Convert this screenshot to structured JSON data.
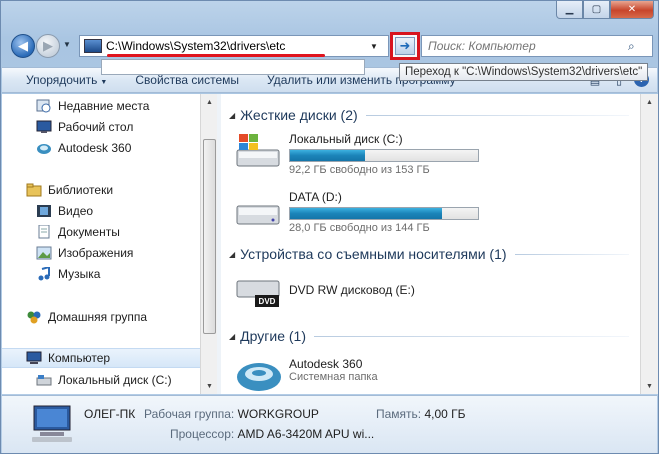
{
  "window": {
    "caption": {
      "minimize": "▁",
      "maximize": "▢",
      "close": "✕"
    }
  },
  "nav": {
    "address_value": "C:\\Windows\\System32\\drivers\\etc",
    "search_placeholder": "Поиск: Компьютер",
    "go_tooltip": "Переход к \"C:\\Windows\\System32\\drivers\\etc\""
  },
  "toolbar": {
    "organize": "Упорядочить",
    "system_properties": "Свойства системы",
    "uninstall": "Удалить или изменить программу"
  },
  "sidebar": {
    "items": [
      {
        "label": "Недавние места",
        "icon": "recent-places-icon"
      },
      {
        "label": "Рабочий стол",
        "icon": "desktop-icon"
      },
      {
        "label": "Autodesk 360",
        "icon": "autodesk-icon"
      },
      {
        "label": "Библиотеки",
        "icon": "libraries-icon"
      },
      {
        "label": "Видео",
        "icon": "video-icon"
      },
      {
        "label": "Документы",
        "icon": "documents-icon"
      },
      {
        "label": "Изображения",
        "icon": "pictures-icon"
      },
      {
        "label": "Музыка",
        "icon": "music-icon"
      },
      {
        "label": "Домашняя группа",
        "icon": "homegroup-icon"
      },
      {
        "label": "Компьютер",
        "icon": "computer-icon"
      },
      {
        "label": "Локальный диск (C:)",
        "icon": "drive-icon"
      }
    ]
  },
  "content": {
    "groups": [
      {
        "title": "Жесткие диски (2)"
      },
      {
        "title": "Устройства со съемными носителями (1)"
      },
      {
        "title": "Другие (1)"
      }
    ],
    "drives": [
      {
        "name": "Локальный диск (C:)",
        "free_text": "92,2 ГБ свободно из 153 ГБ",
        "used_fraction": 0.4
      },
      {
        "name": "DATA (D:)",
        "free_text": "28,0 ГБ свободно из 144 ГБ",
        "used_fraction": 0.81
      }
    ],
    "removable": [
      {
        "name": "DVD RW дисковод (E:)",
        "badge": "DVD"
      }
    ],
    "other": [
      {
        "name": "Autodesk 360",
        "subtitle": "Системная папка"
      }
    ]
  },
  "status": {
    "computer_name": "ОЛЕГ-ПК",
    "workgroup_label": "Рабочая группа:",
    "workgroup_value": "WORKGROUP",
    "memory_label": "Память:",
    "memory_value": "4,00 ГБ",
    "cpu_label": "Процессор:",
    "cpu_value": "AMD A6-3420M APU wi..."
  },
  "colors": {
    "accent_red": "#d8141e",
    "bar_fill": "#1b84b9",
    "group_title": "#1e395b"
  }
}
